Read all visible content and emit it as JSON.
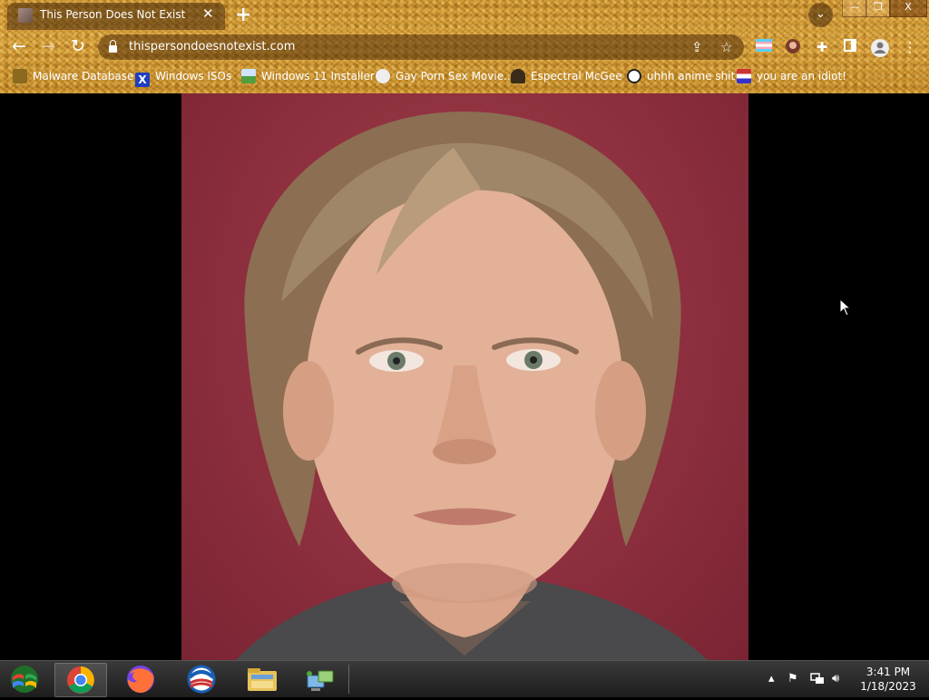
{
  "tab": {
    "title": "This Person Does Not Exist"
  },
  "address_bar": {
    "url": "thispersondoesnotexist.com"
  },
  "window_controls": {
    "close_label": "X"
  },
  "bookmarks": [
    {
      "label": "Malware Database",
      "icon": "leaf-icon"
    },
    {
      "label": "Windows ISOs",
      "icon": "x-icon"
    },
    {
      "label": "Windows 11 Installer",
      "icon": "image-icon"
    },
    {
      "label": "Gay Porn Sex Movie...",
      "icon": "globe-icon"
    },
    {
      "label": "Espectral McGee",
      "icon": "figure-icon"
    },
    {
      "label": "uhhh anime shit",
      "icon": "face-icon"
    },
    {
      "label": "you are an idiot!",
      "icon": "flag-icon"
    }
  ],
  "taskbar": {
    "apps": [
      "start-orb",
      "chrome",
      "firefox",
      "internet-explorer",
      "file-explorer",
      "network"
    ],
    "clock": {
      "time": "3:41 PM",
      "date": "1/18/2023"
    }
  },
  "colors": {
    "page_bg": "#000000",
    "photo_bg": "#8d2f3e",
    "theme_gold": "#c8902e"
  }
}
